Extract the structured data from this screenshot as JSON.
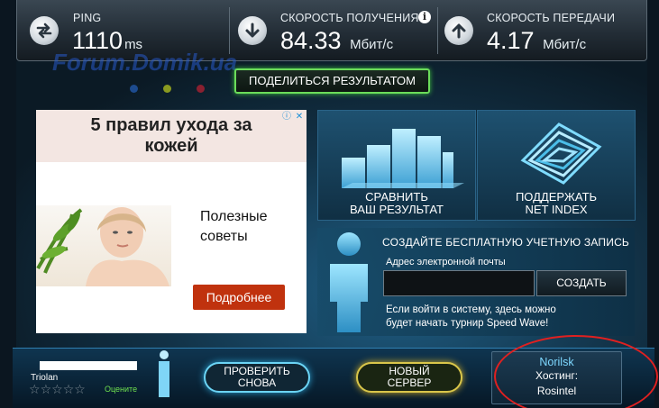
{
  "metrics": {
    "ping": {
      "label": "PING",
      "value": "1110",
      "unit": "ms"
    },
    "download": {
      "label": "СКОРОСТЬ ПОЛУЧЕНИЯ",
      "value": "84.33",
      "unit": "Мбит/с"
    },
    "upload": {
      "label": "СКОРОСТЬ ПЕРЕДАЧИ",
      "value": "4.17",
      "unit": "Мбит/с"
    }
  },
  "watermark": "Forum.Domik.ua",
  "share_button": "ПОДЕЛИТЬСЯ РЕЗУЛЬТАТОМ",
  "ad": {
    "title_line1": "5 правил ухода за",
    "title_line2": "кожей",
    "text_line1": "Полезные",
    "text_line2": "советы",
    "more_button": "Подробнее"
  },
  "tiles": {
    "compare_line1": "СРАВНИТЬ",
    "compare_line2": "ВАШ РЕЗУЛЬТАТ",
    "support_line1": "ПОДДЕРЖАТЬ",
    "support_line2": "NET INDEX"
  },
  "signup": {
    "title": "СОЗДАЙТЕ БЕСПЛАТНУЮ УЧЕТНУЮ ЗАПИСЬ",
    "email_label": "Адрес электронной почты",
    "email_value": "",
    "create_button": "СОЗДАТЬ",
    "note_line1": "Если войти в систему, здесь можно",
    "note_line2": "будет начать турнир Speed Wave!"
  },
  "bottom": {
    "isp_label": "Triolan",
    "rate_label": "Оцените",
    "rating_stars": 0,
    "retest_line1": "ПРОВЕРИТЬ",
    "retest_line2": "СНОВА",
    "newserver_line1": "НОВЫЙ",
    "newserver_line2": "СЕРВЕР",
    "server_city": "Norilsk",
    "host_label": "Хостинг:",
    "host_name": "Rosintel"
  },
  "colors": {
    "share_border": "#6bdc5a",
    "retest_border": "#6bd4f5",
    "newserver_border": "#d9c64a",
    "ad_button": "#c0320e",
    "annotation_circle": "#e02020"
  }
}
